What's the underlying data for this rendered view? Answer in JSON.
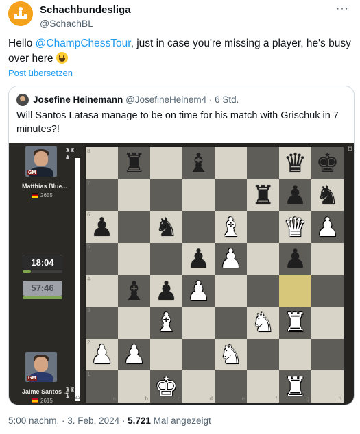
{
  "account": {
    "name": "Schachbundesliga",
    "handle": "@SchachBL",
    "more_icon": "more-horizontal-icon"
  },
  "tweet": {
    "text_before": "Hello ",
    "mention": "@ChampChessTour",
    "text_after": ", just in case you're missing a player, he's busy over here ",
    "emoji": "grinning-face",
    "translate": "Post übersetzen"
  },
  "quote": {
    "name": "Josefine Heinemann",
    "handle": "@JosefineHeinem4",
    "separator": " · ",
    "time": "6 Std.",
    "text": "Will Santos Latasa manage to be on time for his match with Grischuk in 7 minutes?!"
  },
  "broadcast": {
    "top_player": {
      "name": "Matthias Blue...",
      "rating": "2655",
      "title": "GM",
      "flag": "DE"
    },
    "bottom_player": {
      "name": "Jaime Santos ...",
      "rating": "2615",
      "title": "GM",
      "flag": "ES"
    },
    "clock_top": "18:04",
    "clock_bottom": "57:46",
    "eval": "3.3",
    "files": [
      "a",
      "b",
      "c",
      "d",
      "e",
      "f",
      "g",
      "h"
    ],
    "ranks": [
      "8",
      "7",
      "6",
      "5",
      "4",
      "3",
      "2",
      "1"
    ],
    "board": [
      [
        "",
        "bR",
        "",
        "bB",
        "",
        "",
        "bQ",
        "bK"
      ],
      [
        "",
        "",
        "",
        "",
        "",
        "bR",
        "bP",
        "bN"
      ],
      [
        "bP",
        "",
        "bN",
        "",
        "wB",
        "",
        "wQ",
        "wP"
      ],
      [
        "",
        "",
        "",
        "bP",
        "wP",
        "",
        "bP",
        ""
      ],
      [
        "",
        "bB",
        "bP",
        "wP",
        "",
        "",
        "",
        ""
      ],
      [
        "",
        "",
        "wB",
        "",
        "",
        "wN",
        "wR",
        ""
      ],
      [
        "wP",
        "wP",
        "",
        "",
        "wN",
        "",
        "",
        ""
      ],
      [
        "",
        "",
        "wK",
        "",
        "",
        "",
        "wR",
        ""
      ]
    ],
    "highlight": "g4"
  },
  "footer": {
    "time": "5:00 nachm.",
    "sep1": " · ",
    "date": "3. Feb. 2024",
    "sep2": " · ",
    "views": "5.721",
    "views_label": " Mal angezeigt"
  }
}
